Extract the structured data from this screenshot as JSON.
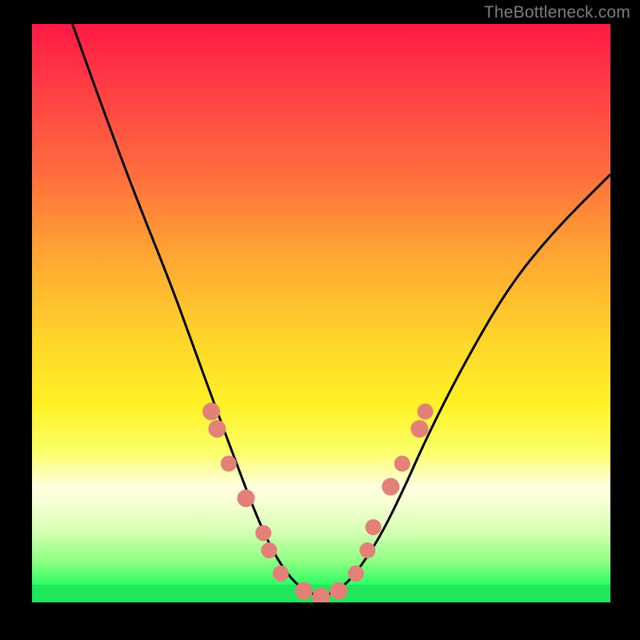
{
  "watermark": "TheBottleneck.com",
  "chart_data": {
    "type": "line",
    "title": "",
    "xlabel": "",
    "ylabel": "",
    "xlim": [
      0,
      100
    ],
    "ylim": [
      0,
      100
    ],
    "grid": false,
    "legend": false,
    "series": [
      {
        "name": "bottleneck-curve",
        "x": [
          7,
          12,
          18,
          24,
          28,
          32,
          35,
          38,
          41,
          44,
          47,
          50,
          53,
          56,
          60,
          64,
          68,
          74,
          82,
          90,
          100
        ],
        "y": [
          100,
          86,
          70,
          55,
          44,
          33,
          25,
          17,
          10,
          5,
          2,
          1,
          2,
          5,
          11,
          19,
          28,
          40,
          54,
          64,
          74
        ]
      }
    ],
    "markers": [
      {
        "x": 31,
        "y": 33,
        "r": 11
      },
      {
        "x": 32,
        "y": 30,
        "r": 11
      },
      {
        "x": 34,
        "y": 24,
        "r": 10
      },
      {
        "x": 37,
        "y": 18,
        "r": 11
      },
      {
        "x": 40,
        "y": 12,
        "r": 10
      },
      {
        "x": 41,
        "y": 9,
        "r": 10
      },
      {
        "x": 43,
        "y": 5,
        "r": 10
      },
      {
        "x": 47,
        "y": 2,
        "r": 11
      },
      {
        "x": 50,
        "y": 1,
        "r": 11
      },
      {
        "x": 53,
        "y": 2,
        "r": 11
      },
      {
        "x": 56,
        "y": 5,
        "r": 10
      },
      {
        "x": 58,
        "y": 9,
        "r": 10
      },
      {
        "x": 59,
        "y": 13,
        "r": 10
      },
      {
        "x": 62,
        "y": 20,
        "r": 11
      },
      {
        "x": 64,
        "y": 24,
        "r": 10
      },
      {
        "x": 67,
        "y": 30,
        "r": 11
      },
      {
        "x": 68,
        "y": 33,
        "r": 10
      }
    ],
    "marker_color": "#e38178",
    "curve_color": "#000000",
    "curve_width": 3
  }
}
